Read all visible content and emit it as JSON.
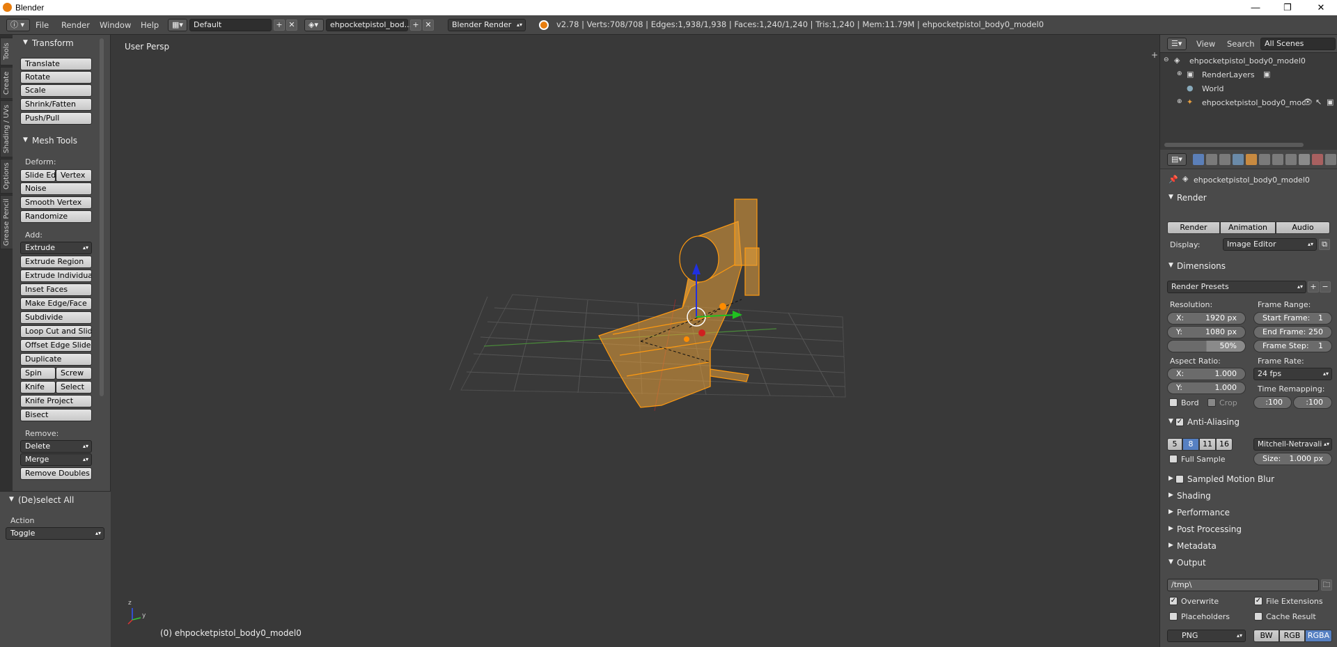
{
  "window": {
    "title": "Blender",
    "controls": {
      "minimize": "—",
      "maximize": "❐",
      "close": "✕"
    }
  },
  "menubar": {
    "items": [
      "File",
      "Render",
      "Window",
      "Help"
    ],
    "layout": "Default",
    "scene": "ehpocketpistol_bod...",
    "engine": "Blender Render",
    "stats": "v2.78 | Verts:708/708 | Edges:1,938/1,938 | Faces:1,240/1,240 | Tris:1,240 | Mem:11.79M | ehpocketpistol_body0_model0"
  },
  "tool_tabs": [
    "Tools",
    "Create",
    "Shading / UVs",
    "Options",
    "Grease Pencil"
  ],
  "toolshelf": {
    "transform": {
      "title": "Transform",
      "buttons": [
        "Translate",
        "Rotate",
        "Scale",
        "Shrink/Fatten",
        "Push/Pull"
      ]
    },
    "mesh_tools": {
      "title": "Mesh Tools",
      "deform_label": "Deform:",
      "deform": [
        "Slide Ed",
        "Vertex",
        "Noise",
        "Smooth Vertex",
        "Randomize"
      ],
      "add_label": "Add:",
      "extrude": "Extrude",
      "add": [
        "Extrude Region",
        "Extrude Individual",
        "Inset Faces",
        "Make Edge/Face",
        "Subdivide",
        "Loop Cut and Slide",
        "Offset Edge Slide",
        "Duplicate",
        "Spin",
        "Screw",
        "Knife",
        "Select",
        "Knife Project",
        "Bisect"
      ],
      "remove_label": "Remove:",
      "delete": "Delete",
      "merge": "Merge",
      "remove_doubles": "Remove Doubles"
    }
  },
  "operator_panel": {
    "title": "(De)select All",
    "action_label": "Action",
    "action_value": "Toggle"
  },
  "viewport": {
    "view_label": "User Persp",
    "object_label": "(0) ehpocketpistol_body0_model0",
    "axis_y": "y",
    "axis_z": "z"
  },
  "outliner": {
    "view": "View",
    "search": "Search",
    "filter": "All Scenes",
    "rows": [
      "ehpocketpistol_body0_model0",
      "RenderLayers",
      "World",
      "ehpocketpistol_body0_moc"
    ]
  },
  "properties": {
    "object_name": "ehpocketpistol_body0_model0",
    "render": {
      "title": "Render",
      "render_btn": "Render",
      "animation_btn": "Animation",
      "audio_btn": "Audio",
      "display_label": "Display:",
      "display_value": "Image Editor"
    },
    "dimensions": {
      "title": "Dimensions",
      "presets": "Render Presets",
      "resolution_label": "Resolution:",
      "res_x_label": "X:",
      "res_x": "1920 px",
      "res_y_label": "Y:",
      "res_y": "1080 px",
      "res_pct": "50%",
      "frame_range_label": "Frame Range:",
      "start_label": "Start Frame:",
      "start": "1",
      "end_label": "End Frame:",
      "end": "250",
      "step_label": "Frame Step:",
      "step": "1",
      "aspect_label": "Aspect Ratio:",
      "asp_x_label": "X:",
      "asp_x": "1.000",
      "asp_y_label": "Y:",
      "asp_y": "1.000",
      "frame_rate_label": "Frame Rate:",
      "frame_rate": "24 fps",
      "time_remap_label": "Time Remapping:",
      "remap_old": ":100",
      "remap_new": ":100",
      "bord": "Bord",
      "crop": "Crop"
    },
    "anti_aliasing": {
      "title": "Anti-Aliasing",
      "samples": [
        "5",
        "8",
        "11",
        "16"
      ],
      "filter": "Mitchell-Netravali",
      "full_sample": "Full Sample",
      "size_label": "Size:",
      "size": "1.000 px"
    },
    "collapsed_panels": [
      "Sampled Motion Blur",
      "Shading",
      "Performance",
      "Post Processing",
      "Metadata"
    ],
    "output": {
      "title": "Output",
      "path": "/tmp\\",
      "overwrite": "Overwrite",
      "file_extensions": "File Extensions",
      "placeholders": "Placeholders",
      "cache_result": "Cache Result",
      "format": "PNG",
      "color_modes": [
        "BW",
        "RGB",
        "RGBA"
      ]
    }
  }
}
